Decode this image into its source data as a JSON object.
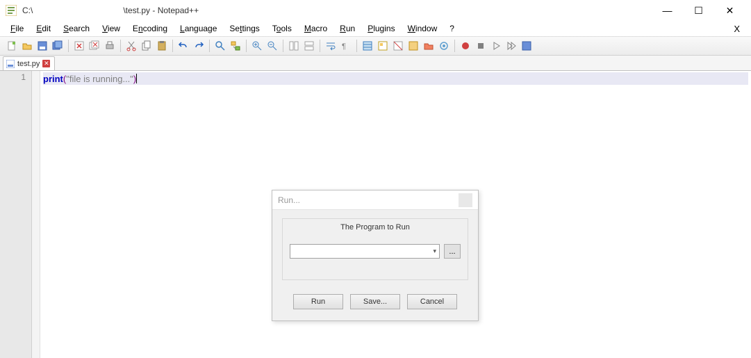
{
  "titlebar": {
    "path": "C:\\",
    "title": "\\test.py - Notepad++"
  },
  "window_controls": {
    "minimize": "—",
    "maximize": "☐",
    "close": "✕",
    "menu_x": "X"
  },
  "menu": {
    "file": "File",
    "edit": "Edit",
    "search": "Search",
    "view": "View",
    "encoding": "Encoding",
    "language": "Language",
    "settings": "Settings",
    "tools": "Tools",
    "macro": "Macro",
    "run": "Run",
    "plugins": "Plugins",
    "window": "Window",
    "help": "?"
  },
  "tab": {
    "name": "test.py"
  },
  "editor": {
    "line_number": "1",
    "code": {
      "keyword": "print",
      "lparen": "(",
      "string": "\"file is running...\"",
      "rparen": ")"
    }
  },
  "dialog": {
    "title": "Run...",
    "group_label": "The Program to Run",
    "combo_value": "",
    "browse": "...",
    "run": "Run",
    "save": "Save...",
    "cancel": "Cancel"
  },
  "colors": {
    "keyword": "#0000c0",
    "string": "#808080",
    "paren": "#800080",
    "active_line": "#e8e8f4"
  }
}
